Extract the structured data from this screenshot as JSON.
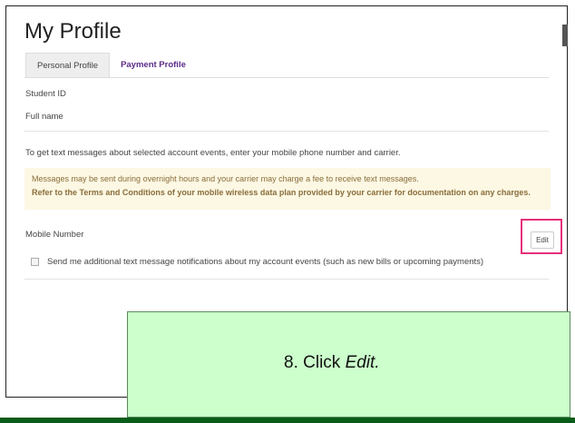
{
  "page": {
    "title": "My Profile"
  },
  "tabs": [
    {
      "label": "Personal Profile",
      "active": true
    },
    {
      "label": "Payment Profile",
      "active": false
    }
  ],
  "fields": {
    "student_id": "Student ID",
    "full_name": "Full name"
  },
  "sms": {
    "intro": "To get text messages about selected account events, enter your mobile phone number and carrier.",
    "notice_line1": "Messages may be sent during overnight hours and your carrier may charge a fee to receive text messages.",
    "notice_line2": "Refer to the Terms and Conditions of your mobile wireless data plan provided by your carrier for documentation on any charges.",
    "mobile_label": "Mobile Number",
    "edit_label": "Edit",
    "checkbox_label": "Send me additional text message notifications about my account events (such as new bills or upcoming payments)",
    "checkbox_checked": false
  },
  "callout": {
    "step": "8. Click ",
    "action": "Edit."
  },
  "colors": {
    "tab_link": "#5b2a86",
    "notice_bg": "#fcf8e3",
    "highlight": "#e5307a",
    "callout_bg": "#ccffcc",
    "bottom_bar": "#0a5c1a"
  }
}
